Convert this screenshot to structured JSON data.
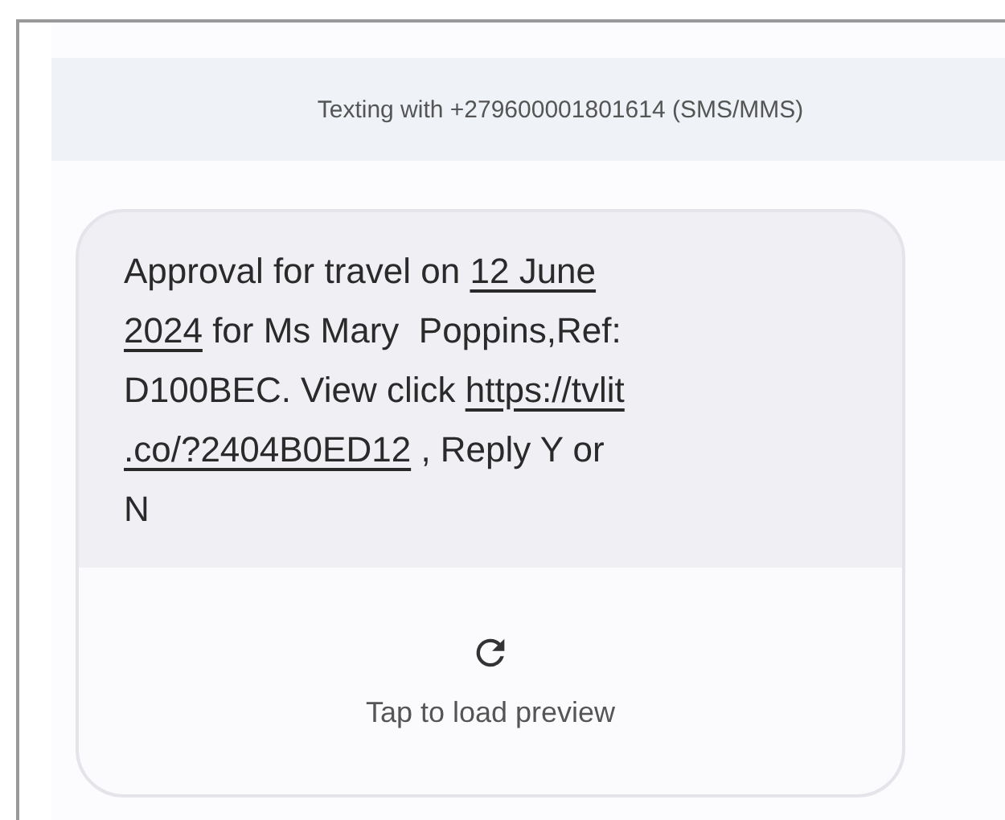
{
  "banner": {
    "text": "Texting with +279600001801614 (SMS/MMS)"
  },
  "message": {
    "lines": [
      [
        {
          "kind": "text",
          "text": "Approval for travel on "
        },
        {
          "kind": "link",
          "text": "12 June"
        }
      ],
      [
        {
          "kind": "link",
          "text": "2024"
        },
        {
          "kind": "text",
          "text": " for Ms Mary  Poppins,Ref:"
        }
      ],
      [
        {
          "kind": "text",
          "text": "D100BEC. View click "
        },
        {
          "kind": "link",
          "text": "https://tvlit"
        }
      ],
      [
        {
          "kind": "link",
          "text": ".co/?2404B0ED12"
        },
        {
          "kind": "text",
          "text": " , Reply Y or"
        }
      ],
      [
        {
          "kind": "text",
          "text": "N"
        }
      ]
    ]
  },
  "preview": {
    "label": "Tap to load preview"
  }
}
